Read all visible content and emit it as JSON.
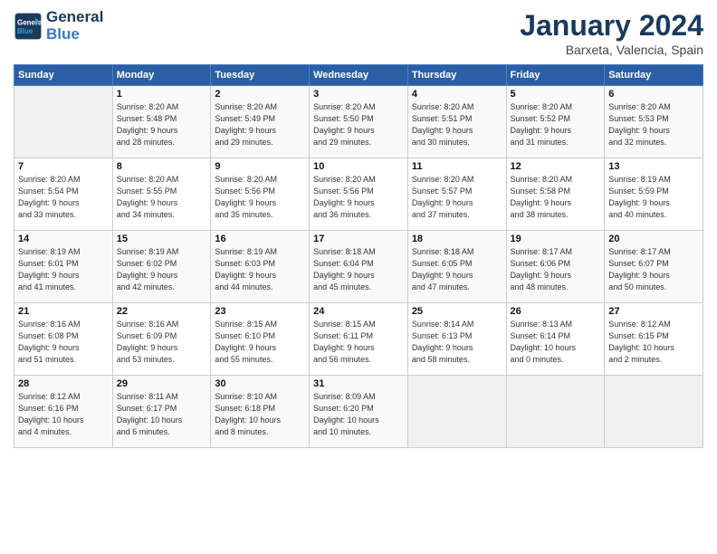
{
  "header": {
    "logo_line1": "General",
    "logo_line2": "Blue",
    "month": "January 2024",
    "location": "Barxeta, Valencia, Spain"
  },
  "weekdays": [
    "Sunday",
    "Monday",
    "Tuesday",
    "Wednesday",
    "Thursday",
    "Friday",
    "Saturday"
  ],
  "weeks": [
    [
      {
        "day": "",
        "info": ""
      },
      {
        "day": "1",
        "info": "Sunrise: 8:20 AM\nSunset: 5:48 PM\nDaylight: 9 hours\nand 28 minutes."
      },
      {
        "day": "2",
        "info": "Sunrise: 8:20 AM\nSunset: 5:49 PM\nDaylight: 9 hours\nand 29 minutes."
      },
      {
        "day": "3",
        "info": "Sunrise: 8:20 AM\nSunset: 5:50 PM\nDaylight: 9 hours\nand 29 minutes."
      },
      {
        "day": "4",
        "info": "Sunrise: 8:20 AM\nSunset: 5:51 PM\nDaylight: 9 hours\nand 30 minutes."
      },
      {
        "day": "5",
        "info": "Sunrise: 8:20 AM\nSunset: 5:52 PM\nDaylight: 9 hours\nand 31 minutes."
      },
      {
        "day": "6",
        "info": "Sunrise: 8:20 AM\nSunset: 5:53 PM\nDaylight: 9 hours\nand 32 minutes."
      }
    ],
    [
      {
        "day": "7",
        "info": "Sunrise: 8:20 AM\nSunset: 5:54 PM\nDaylight: 9 hours\nand 33 minutes."
      },
      {
        "day": "8",
        "info": "Sunrise: 8:20 AM\nSunset: 5:55 PM\nDaylight: 9 hours\nand 34 minutes."
      },
      {
        "day": "9",
        "info": "Sunrise: 8:20 AM\nSunset: 5:56 PM\nDaylight: 9 hours\nand 35 minutes."
      },
      {
        "day": "10",
        "info": "Sunrise: 8:20 AM\nSunset: 5:56 PM\nDaylight: 9 hours\nand 36 minutes."
      },
      {
        "day": "11",
        "info": "Sunrise: 8:20 AM\nSunset: 5:57 PM\nDaylight: 9 hours\nand 37 minutes."
      },
      {
        "day": "12",
        "info": "Sunrise: 8:20 AM\nSunset: 5:58 PM\nDaylight: 9 hours\nand 38 minutes."
      },
      {
        "day": "13",
        "info": "Sunrise: 8:19 AM\nSunset: 5:59 PM\nDaylight: 9 hours\nand 40 minutes."
      }
    ],
    [
      {
        "day": "14",
        "info": "Sunrise: 8:19 AM\nSunset: 6:01 PM\nDaylight: 9 hours\nand 41 minutes."
      },
      {
        "day": "15",
        "info": "Sunrise: 8:19 AM\nSunset: 6:02 PM\nDaylight: 9 hours\nand 42 minutes."
      },
      {
        "day": "16",
        "info": "Sunrise: 8:19 AM\nSunset: 6:03 PM\nDaylight: 9 hours\nand 44 minutes."
      },
      {
        "day": "17",
        "info": "Sunrise: 8:18 AM\nSunset: 6:04 PM\nDaylight: 9 hours\nand 45 minutes."
      },
      {
        "day": "18",
        "info": "Sunrise: 8:18 AM\nSunset: 6:05 PM\nDaylight: 9 hours\nand 47 minutes."
      },
      {
        "day": "19",
        "info": "Sunrise: 8:17 AM\nSunset: 6:06 PM\nDaylight: 9 hours\nand 48 minutes."
      },
      {
        "day": "20",
        "info": "Sunrise: 8:17 AM\nSunset: 6:07 PM\nDaylight: 9 hours\nand 50 minutes."
      }
    ],
    [
      {
        "day": "21",
        "info": "Sunrise: 8:16 AM\nSunset: 6:08 PM\nDaylight: 9 hours\nand 51 minutes."
      },
      {
        "day": "22",
        "info": "Sunrise: 8:16 AM\nSunset: 6:09 PM\nDaylight: 9 hours\nand 53 minutes."
      },
      {
        "day": "23",
        "info": "Sunrise: 8:15 AM\nSunset: 6:10 PM\nDaylight: 9 hours\nand 55 minutes."
      },
      {
        "day": "24",
        "info": "Sunrise: 8:15 AM\nSunset: 6:11 PM\nDaylight: 9 hours\nand 56 minutes."
      },
      {
        "day": "25",
        "info": "Sunrise: 8:14 AM\nSunset: 6:13 PM\nDaylight: 9 hours\nand 58 minutes."
      },
      {
        "day": "26",
        "info": "Sunrise: 8:13 AM\nSunset: 6:14 PM\nDaylight: 10 hours\nand 0 minutes."
      },
      {
        "day": "27",
        "info": "Sunrise: 8:12 AM\nSunset: 6:15 PM\nDaylight: 10 hours\nand 2 minutes."
      }
    ],
    [
      {
        "day": "28",
        "info": "Sunrise: 8:12 AM\nSunset: 6:16 PM\nDaylight: 10 hours\nand 4 minutes."
      },
      {
        "day": "29",
        "info": "Sunrise: 8:11 AM\nSunset: 6:17 PM\nDaylight: 10 hours\nand 6 minutes."
      },
      {
        "day": "30",
        "info": "Sunrise: 8:10 AM\nSunset: 6:18 PM\nDaylight: 10 hours\nand 8 minutes."
      },
      {
        "day": "31",
        "info": "Sunrise: 8:09 AM\nSunset: 6:20 PM\nDaylight: 10 hours\nand 10 minutes."
      },
      {
        "day": "",
        "info": ""
      },
      {
        "day": "",
        "info": ""
      },
      {
        "day": "",
        "info": ""
      }
    ]
  ]
}
